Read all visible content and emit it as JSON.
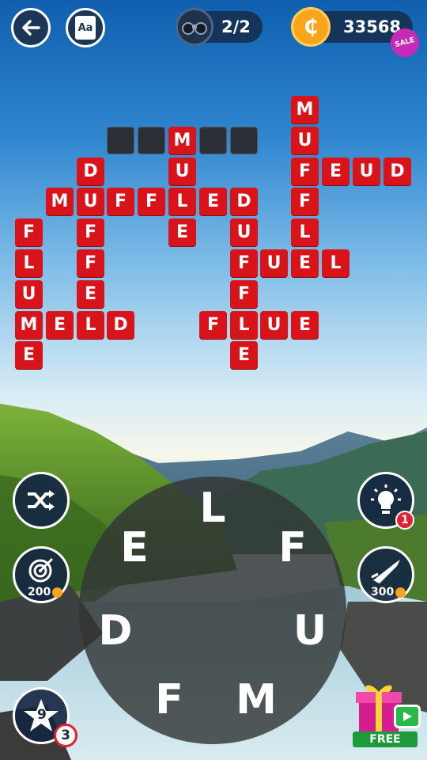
{
  "header": {
    "back_icon": "arrow-left-icon",
    "dictionary_icon": "dictionary-icon",
    "dictionary_label": "Aa",
    "bonus_icon": "binoculars-icon",
    "bonus_count": "2/2",
    "coin_icon": "coin-icon",
    "coin_symbol": "₵",
    "coins": "33568",
    "sale_label": "SALE"
  },
  "grid": {
    "filled_color": "#d8141a",
    "empty_color": "#2b2f36",
    "cells": [
      {
        "r": 0,
        "c": 9,
        "ch": "M"
      },
      {
        "r": 1,
        "c": 3,
        "ch": ""
      },
      {
        "r": 1,
        "c": 4,
        "ch": ""
      },
      {
        "r": 1,
        "c": 5,
        "ch": "M"
      },
      {
        "r": 1,
        "c": 6,
        "ch": ""
      },
      {
        "r": 1,
        "c": 7,
        "ch": ""
      },
      {
        "r": 1,
        "c": 9,
        "ch": "U"
      },
      {
        "r": 2,
        "c": 2,
        "ch": "D"
      },
      {
        "r": 2,
        "c": 5,
        "ch": "U"
      },
      {
        "r": 2,
        "c": 9,
        "ch": "F"
      },
      {
        "r": 2,
        "c": 10,
        "ch": "E"
      },
      {
        "r": 2,
        "c": 11,
        "ch": "U"
      },
      {
        "r": 2,
        "c": 12,
        "ch": "D"
      },
      {
        "r": 3,
        "c": 1,
        "ch": "M"
      },
      {
        "r": 3,
        "c": 2,
        "ch": "U"
      },
      {
        "r": 3,
        "c": 3,
        "ch": "F"
      },
      {
        "r": 3,
        "c": 4,
        "ch": "F"
      },
      {
        "r": 3,
        "c": 5,
        "ch": "L"
      },
      {
        "r": 3,
        "c": 6,
        "ch": "E"
      },
      {
        "r": 3,
        "c": 7,
        "ch": "D"
      },
      {
        "r": 3,
        "c": 9,
        "ch": "F"
      },
      {
        "r": 4,
        "c": 0,
        "ch": "F"
      },
      {
        "r": 4,
        "c": 2,
        "ch": "F"
      },
      {
        "r": 4,
        "c": 5,
        "ch": "E"
      },
      {
        "r": 4,
        "c": 7,
        "ch": "U"
      },
      {
        "r": 4,
        "c": 9,
        "ch": "L"
      },
      {
        "r": 5,
        "c": 0,
        "ch": "L"
      },
      {
        "r": 5,
        "c": 2,
        "ch": "F"
      },
      {
        "r": 5,
        "c": 7,
        "ch": "F"
      },
      {
        "r": 5,
        "c": 8,
        "ch": "U"
      },
      {
        "r": 5,
        "c": 9,
        "ch": "E"
      },
      {
        "r": 5,
        "c": 10,
        "ch": "L"
      },
      {
        "r": 6,
        "c": 0,
        "ch": "U"
      },
      {
        "r": 6,
        "c": 2,
        "ch": "E"
      },
      {
        "r": 6,
        "c": 7,
        "ch": "F"
      },
      {
        "r": 7,
        "c": 0,
        "ch": "M"
      },
      {
        "r": 7,
        "c": 1,
        "ch": "E"
      },
      {
        "r": 7,
        "c": 2,
        "ch": "L"
      },
      {
        "r": 7,
        "c": 3,
        "ch": "D"
      },
      {
        "r": 7,
        "c": 6,
        "ch": "F"
      },
      {
        "r": 7,
        "c": 7,
        "ch": "L"
      },
      {
        "r": 7,
        "c": 8,
        "ch": "U"
      },
      {
        "r": 7,
        "c": 9,
        "ch": "E"
      },
      {
        "r": 8,
        "c": 0,
        "ch": "E"
      },
      {
        "r": 8,
        "c": 7,
        "ch": "E"
      }
    ]
  },
  "wheel": {
    "letters": [
      "L",
      "F",
      "U",
      "M",
      "F",
      "D",
      "E"
    ]
  },
  "controls": {
    "shuffle_icon": "shuffle-icon",
    "target_icon": "target-icon",
    "target_cost": "200",
    "hint_icon": "lightbulb-icon",
    "hint_badge": "1",
    "rocket_icon": "rocket-icon",
    "rocket_cost": "300",
    "star_icon": "star-icon",
    "star_count": "9",
    "star_badge": "3",
    "gift_icon": "gift-icon",
    "free_label": "FREE"
  }
}
